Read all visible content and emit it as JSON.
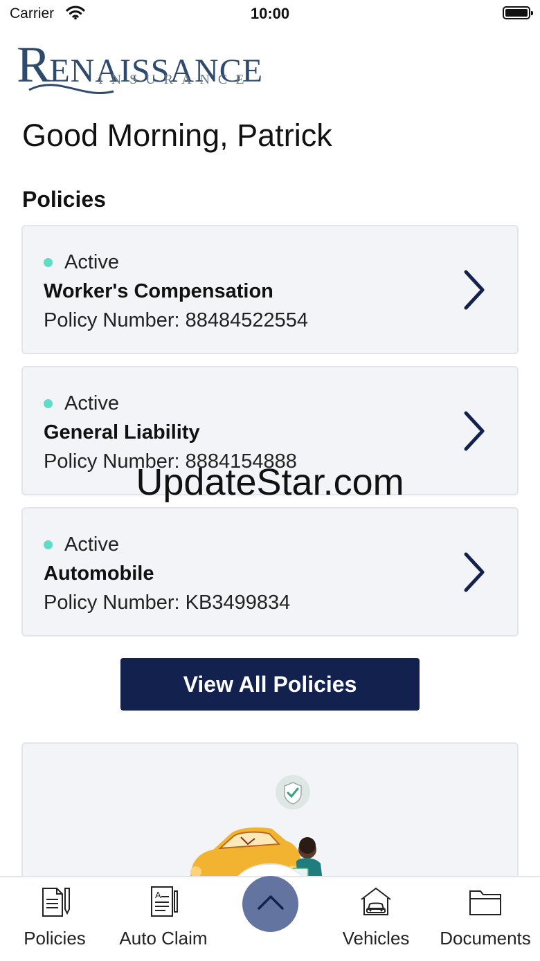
{
  "status_bar": {
    "carrier": "Carrier",
    "time": "10:00"
  },
  "logo": {
    "main_initial": "R",
    "main_rest": "ENAISSANCE",
    "sub": "INSURANCE"
  },
  "greeting": "Good Morning, Patrick",
  "policies": {
    "title": "Policies",
    "items": [
      {
        "status": "Active",
        "name": "Worker's Compensation",
        "number_label": "Policy Number:",
        "number": "88484522554"
      },
      {
        "status": "Active",
        "name": "General Liability",
        "number_label": "Policy Number:",
        "number": "8884154888"
      },
      {
        "status": "Active",
        "name": "Automobile",
        "number_label": "Policy Number:",
        "number": "KB3499834"
      }
    ],
    "view_all_label": "View All Policies"
  },
  "watermark": "UpdateStar.com",
  "tab_bar": {
    "tabs": [
      {
        "label": "Policies",
        "icon": "policy-document-icon"
      },
      {
        "label": "Auto Claim",
        "icon": "claim-form-icon"
      },
      {
        "label": "Vehicles",
        "icon": "garage-car-icon"
      },
      {
        "label": "Documents",
        "icon": "folder-icon"
      }
    ],
    "center_icon": "chevron-up-icon"
  },
  "colors": {
    "primary": "#13214f",
    "status_active": "#5fdcc6",
    "card_background": "#f3f4f7",
    "center_button": "#6474a0"
  }
}
